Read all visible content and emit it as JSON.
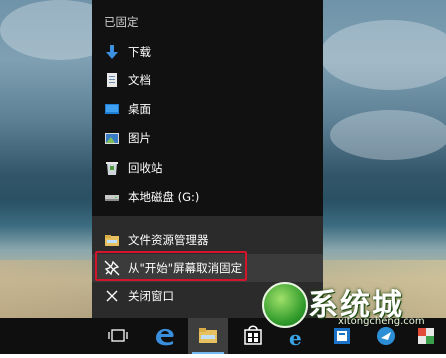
{
  "menu": {
    "section_title": "已固定",
    "items": [
      {
        "label": "下载",
        "icon": "download-arrow-icon"
      },
      {
        "label": "文档",
        "icon": "document-icon"
      },
      {
        "label": "桌面",
        "icon": "desktop-icon"
      },
      {
        "label": "图片",
        "icon": "pictures-icon"
      },
      {
        "label": "回收站",
        "icon": "recycle-bin-icon"
      },
      {
        "label": "本地磁盘 (G:)",
        "icon": "local-disk-icon"
      }
    ],
    "actions": [
      {
        "label": "文件资源管理器",
        "icon": "file-explorer-icon"
      },
      {
        "label": "从\"开始\"屏幕取消固定",
        "icon": "unpin-icon"
      },
      {
        "label": "关闭窗口",
        "icon": "close-icon"
      }
    ]
  },
  "colors": {
    "highlight_border": "#d4142a",
    "menu_bg": "#111111",
    "menu_lower_bg": "#2b2b2b",
    "taskbar_bg": "#0f0f10",
    "accent": "#76b9ed"
  },
  "watermark": {
    "text": "系统城",
    "url": "xitongcheng.com"
  },
  "taskbar": {
    "icons": [
      "task-view-icon",
      "edge-icon",
      "file-explorer-icon",
      "store-icon",
      "internet-explorer-icon",
      "app-icon",
      "bird-app-icon",
      "app-icon"
    ]
  }
}
